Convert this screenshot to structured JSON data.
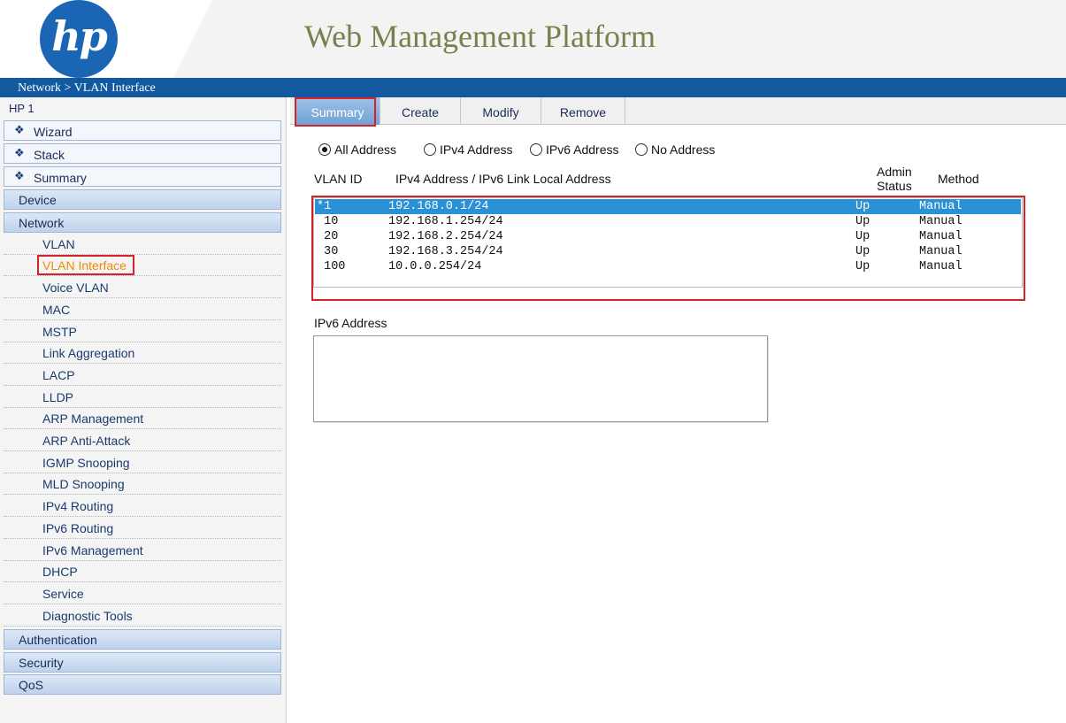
{
  "header": {
    "logo_text": "hp",
    "title": "Web Management Platform",
    "breadcrumb": "Network > VLAN Interface"
  },
  "sidebar": {
    "device_name": "HP 1",
    "shortcuts": [
      {
        "label": "Wizard",
        "icon": "diamond-bullet-icon"
      },
      {
        "label": "Stack",
        "icon": "diamond-bullet-icon"
      },
      {
        "label": "Summary",
        "icon": "diamond-bullet-icon"
      }
    ],
    "sections": {
      "device": "Device",
      "network": "Network",
      "authentication": "Authentication",
      "security": "Security",
      "qos": "QoS"
    },
    "network_items": [
      "VLAN",
      "VLAN Interface",
      "Voice VLAN",
      "MAC",
      "MSTP",
      "Link Aggregation",
      "LACP",
      "LLDP",
      "ARP Management",
      "ARP Anti-Attack",
      "IGMP Snooping",
      "MLD Snooping",
      "IPv4 Routing",
      "IPv6 Routing",
      "IPv6 Management",
      "DHCP",
      "Service",
      "Diagnostic Tools"
    ],
    "active_item": "VLAN Interface"
  },
  "tabs": [
    "Summary",
    "Create",
    "Modify",
    "Remove"
  ],
  "active_tab": "Summary",
  "filters": {
    "options": [
      "All Address",
      "IPv4 Address",
      "IPv6 Address",
      "No Address"
    ],
    "selected": "All Address"
  },
  "table": {
    "headers": {
      "vlan_id": "VLAN ID",
      "address": "IPv4 Address / IPv6 Link Local Address",
      "admin_status_1": "Admin",
      "admin_status_2": "Status",
      "method": "Method"
    },
    "rows": [
      {
        "vlan": "*1",
        "address": "192.168.0.1/24",
        "status": "Up",
        "method": "Manual"
      },
      {
        "vlan": " 10",
        "address": "192.168.1.254/24",
        "status": "Up",
        "method": "Manual"
      },
      {
        "vlan": " 20",
        "address": "192.168.2.254/24",
        "status": "Up",
        "method": "Manual"
      },
      {
        "vlan": " 30",
        "address": "192.168.3.254/24",
        "status": "Up",
        "method": "Manual"
      },
      {
        "vlan": " 100",
        "address": "10.0.0.254/24",
        "status": "Up",
        "method": "Manual"
      }
    ],
    "selected_row": 0
  },
  "ipv6": {
    "label": "IPv6 Address",
    "value": ""
  }
}
